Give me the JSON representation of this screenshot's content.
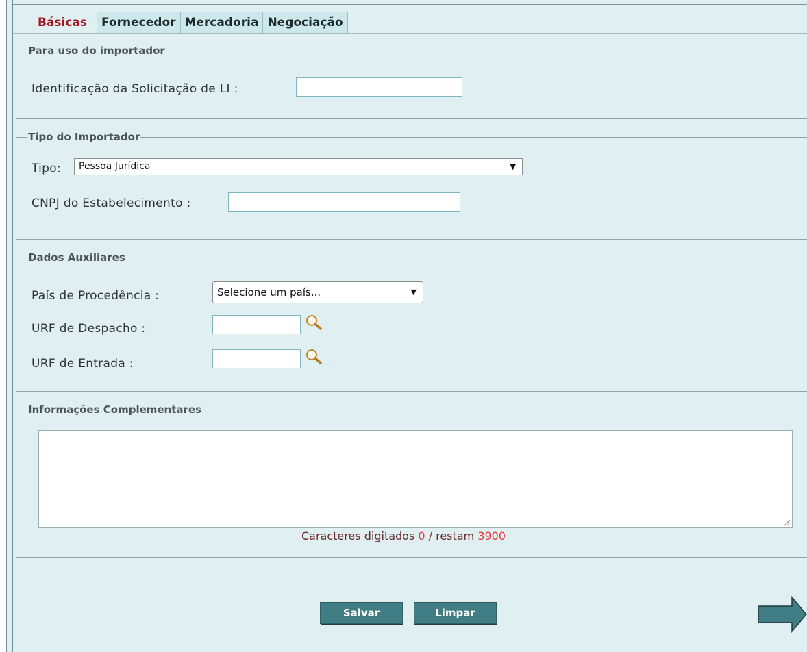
{
  "tabs": [
    {
      "label": "Básicas",
      "active": true
    },
    {
      "label": "Fornecedor",
      "active": false
    },
    {
      "label": "Mercadoria",
      "active": false
    },
    {
      "label": "Negociação",
      "active": false
    }
  ],
  "importador": {
    "legend": "Para uso do importador",
    "id_label": "Identificação da Solicitação de LI :",
    "id_value": ""
  },
  "tipo_importador": {
    "legend": "Tipo do Importador",
    "tipo_label": "Tipo:",
    "tipo_selected": "Pessoa Jurídica",
    "cnpj_label": "CNPJ do Estabelecimento :",
    "cnpj_value": ""
  },
  "dados_auxiliares": {
    "legend": "Dados Auxiliares",
    "pais_label": "País de Procedência :",
    "pais_selected": "Selecione um país...",
    "urf_despacho_label": "URF de Despacho :",
    "urf_despacho_value": "",
    "urf_entrada_label": "URF de Entrada :",
    "urf_entrada_value": ""
  },
  "info_complementares": {
    "legend": "Informações Complementares",
    "text": "",
    "counter_prefix": "Caracteres digitados",
    "typed": "0",
    "counter_mid": "/ restam",
    "remaining": "3900"
  },
  "buttons": {
    "save": "Salvar",
    "clear": "Limpar"
  },
  "colors": {
    "background": "#dfeff2",
    "active_tab_text": "#a3141e",
    "button": "#417d85",
    "counter_number": "#e43b3b"
  },
  "icons": {
    "lookup": "magnifier-icon",
    "next": "arrow-right-icon",
    "dropdown": "triangle-down-icon"
  }
}
